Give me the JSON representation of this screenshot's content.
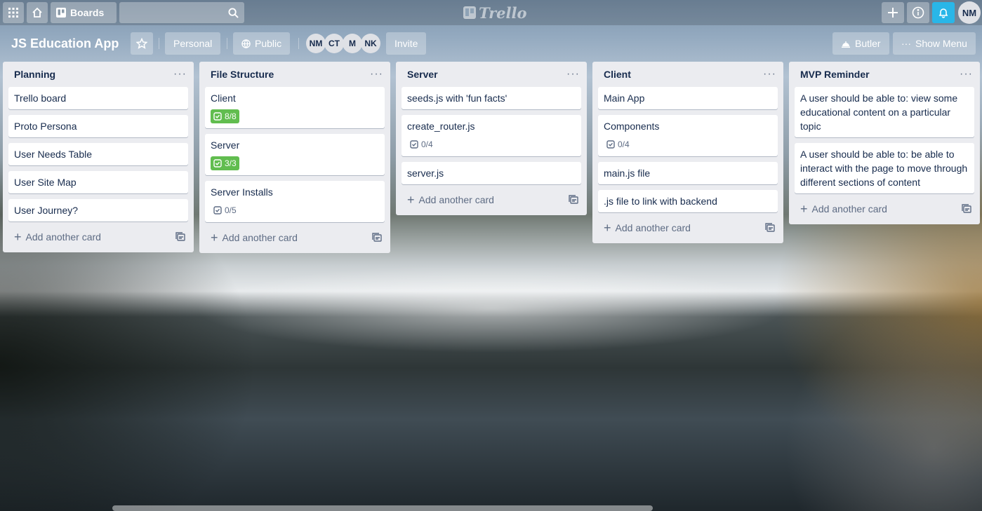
{
  "topbar": {
    "boards_label": "Boards",
    "logo_text": "Trello",
    "avatar_initials": "NM"
  },
  "board": {
    "title": "JS Education App",
    "personal_label": "Personal",
    "public_label": "Public",
    "members": [
      "NM",
      "CT",
      "M",
      "NK"
    ],
    "invite_label": "Invite",
    "butler_label": "Butler",
    "show_menu_label": "Show Menu"
  },
  "lists": [
    {
      "title": "Planning",
      "cards": [
        {
          "title": "Trello board"
        },
        {
          "title": "Proto Persona"
        },
        {
          "title": "User Needs Table"
        },
        {
          "title": "User Site Map"
        },
        {
          "title": "User Journey?"
        }
      ],
      "add_label": "Add another card"
    },
    {
      "title": "File Structure",
      "cards": [
        {
          "title": "Client",
          "checklist": "8/8",
          "complete": true
        },
        {
          "title": "Server",
          "checklist": "3/3",
          "complete": true
        },
        {
          "title": "Server Installs",
          "checklist": "0/5",
          "complete": false
        }
      ],
      "add_label": "Add another card"
    },
    {
      "title": "Server",
      "cards": [
        {
          "title": "seeds.js with 'fun facts'"
        },
        {
          "title": "create_router.js",
          "checklist": "0/4",
          "complete": false
        },
        {
          "title": "server.js"
        }
      ],
      "add_label": "Add another card"
    },
    {
      "title": "Client",
      "cards": [
        {
          "title": "Main App"
        },
        {
          "title": "Components",
          "checklist": "0/4",
          "complete": false
        },
        {
          "title": "main.js file"
        },
        {
          "title": ".js file to link with backend"
        }
      ],
      "add_label": "Add another card"
    },
    {
      "title": "MVP Reminder",
      "cards": [
        {
          "title": "A user should be able to: view some educational content on a particular topic"
        },
        {
          "title": "A user should be able to: be able to interact with the page to move through different sections of content"
        }
      ],
      "add_label": "Add another card"
    }
  ],
  "colors": {
    "checklist_complete": "#61bd4f",
    "notification_button": "#29b6e8",
    "list_background": "#ebecf0"
  }
}
